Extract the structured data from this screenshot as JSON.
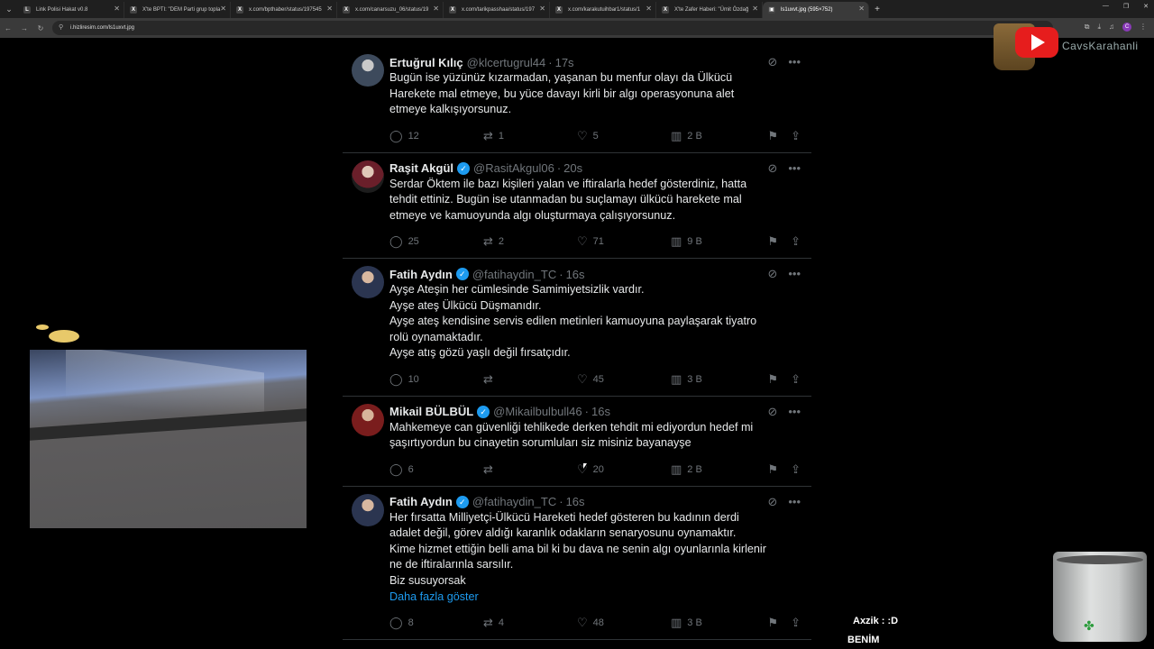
{
  "browser": {
    "tabs": [
      {
        "title": "Link Polisi Hakat v0.8",
        "fav": "L"
      },
      {
        "title": "X'te BPTI: \"DEM Parti grup topla",
        "fav": "X"
      },
      {
        "title": "x.com/bpthaber/status/197545",
        "fav": "X"
      },
      {
        "title": "x.com/canarsuzu_06/status/19",
        "fav": "X"
      },
      {
        "title": "x.com/tarikpasshaa/status/197",
        "fav": "X"
      },
      {
        "title": "x.com/karakutuihbar1/status/1",
        "fav": "X"
      },
      {
        "title": "X'te Zafer Haberi: \"Ümit Özdağ",
        "fav": "X"
      },
      {
        "title": "ls1uxvt.jpg (595×752)",
        "fav": "▣"
      }
    ],
    "url": "i.hizliresim.com/ls1uxvt.jpg",
    "profile_initial": "C"
  },
  "tweets": [
    {
      "name": "Ertuğrul Kılıç",
      "handle": "@klcertugrul44",
      "time": "17s",
      "verified": false,
      "text": "Bugün ise yüzünüz kızarmadan, yaşanan bu menfur olayı da Ülkücü\nHarekete mal etmeye, bu yüce davayı kirli bir algı operasyonuna alet\netmeye kalkışıyorsunuz.",
      "replies": "12",
      "reposts": "1",
      "likes": "5",
      "views": "2 B"
    },
    {
      "name": "Raşit Akgül",
      "handle": "@RasitAkgul06",
      "time": "20s",
      "verified": true,
      "text": "Serdar Öktem ile bazı kişileri yalan ve iftiralarla hedef gösterdiniz, hatta\ntehdit ettiniz. Bugün ise utanmadan bu suçlamayı ülkücü harekete mal\netmeye ve kamuoyunda algı oluşturmaya çalışıyorsunuz.",
      "replies": "25",
      "reposts": "2",
      "likes": "71",
      "views": "9 B"
    },
    {
      "name": "Fatih Aydın",
      "handle": "@fatihaydin_TC",
      "time": "16s",
      "verified": true,
      "text": "Ayşe Ateşin her cümlesinde Samimiyetsizlik vardır.\nAyşe ateş Ülkücü Düşmanıdır.\nAyşe ateş kendisine servis edilen metinleri kamuoyuna paylaşarak tiyatro\nrolü oynamaktadır.\nAyşe atış gözü yaşlı değil fırsatçıdır.",
      "replies": "10",
      "reposts": "",
      "likes": "45",
      "views": "3 B"
    },
    {
      "name": "Mikail BÜLBÜL",
      "handle": "@Mikailbulbull46",
      "time": "16s",
      "verified": true,
      "text": "Mahkemeye can güvenliği tehlikede derken tehdit mi ediyordun hedef mi\nşaşırtıyordun bu cinayetin sorumluları siz misiniz bayanayşe",
      "replies": "6",
      "reposts": "",
      "likes": "20",
      "views": "2 B"
    },
    {
      "name": "Fatih Aydın",
      "handle": "@fatihaydin_TC",
      "time": "16s",
      "verified": true,
      "text": "Her fırsatta Milliyetçi-Ülkücü Hareketi hedef gösteren bu kadının derdi\nadalet değil, görev aldığı karanlık odakların senaryosunu oynamaktır.\nKime hizmet ettiğin belli ama bil ki bu dava ne senin algı oyunlarınla kirlenir\nne de iftiralarınla sarsılır.\nBiz susuyorsak",
      "show_more": "Daha fazla göster",
      "replies": "8",
      "reposts": "4",
      "likes": "48",
      "views": "3 B"
    }
  ],
  "overlay": {
    "channel": "CavsKarahanli",
    "chat_line1": "Axzik : :D",
    "chat_line2": "BENİM"
  },
  "colors": {
    "accent": "#1d9bf0",
    "text": "#e7e9ea",
    "muted": "#71767b",
    "border": "#2f3336",
    "youtube": "#e61d1d"
  }
}
